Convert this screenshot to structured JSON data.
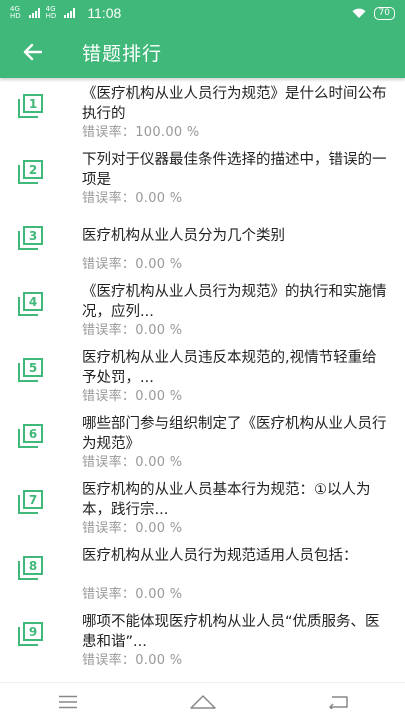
{
  "status": {
    "net1": "4G",
    "net1_sub": "HD",
    "net2": "4G",
    "net2_sub": "HD",
    "time": "11:08",
    "battery": "70"
  },
  "header": {
    "title": "错题排行",
    "back_icon": "back-arrow-icon"
  },
  "items": [
    {
      "num": "1",
      "text": "《医疗机构从业人员行为规范》是什么时间公布执行的",
      "rate": "错误率：100.00 %"
    },
    {
      "num": "2",
      "text": "下列对于仪器最佳条件选择的描述中，错误的一项是",
      "rate": "错误率：0.00 %"
    },
    {
      "num": "3",
      "text": "医疗机构从业人员分为几个类别",
      "rate": "错误率：0.00 %"
    },
    {
      "num": "4",
      "text": "《医疗机构从业人员行为规范》的执行和实施情况，应列...",
      "rate": "错误率：0.00 %"
    },
    {
      "num": "5",
      "text": "医疗机构从业人员违反本规范的,视情节轻重给予处罚，...",
      "rate": "错误率：0.00 %"
    },
    {
      "num": "6",
      "text": "哪些部门参与组织制定了《医疗机构从业人员行为规范》",
      "rate": "错误率：0.00 %"
    },
    {
      "num": "7",
      "text": "医疗机构的从业人员基本行为规范：①以人为本，践行宗...",
      "rate": "错误率：0.00 %"
    },
    {
      "num": "8",
      "text": "医疗机构从业人员行为规范适用人员包括：",
      "rate": "错误率：0.00 %"
    },
    {
      "num": "9",
      "text": "哪项不能体现医疗机构从业人员“优质服务、医患和谐”...",
      "rate": "错误率：0.00 %"
    }
  ],
  "nav": {
    "menu_icon": "menu-icon",
    "home_icon": "home-icon",
    "back_icon": "nav-back-icon"
  },
  "colors": {
    "primary": "#3fb879",
    "rate_text": "#999999"
  }
}
